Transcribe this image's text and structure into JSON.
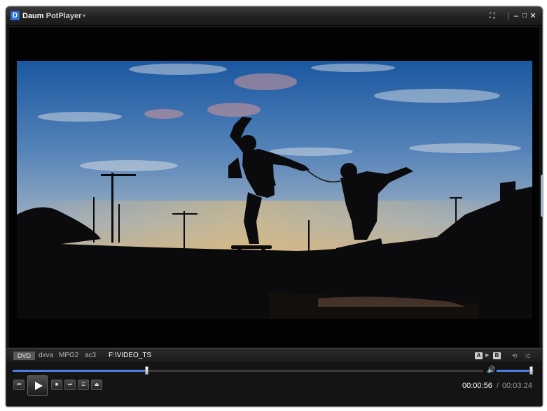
{
  "titlebar": {
    "logo_letter": "D",
    "app_name_part1": "Daum",
    "app_name_part2": " PotPlayer",
    "menu_caret": "▾",
    "btn_fullscreen": "⛶",
    "btn_minimize": "–",
    "btn_maximize": "□",
    "btn_close": "✕"
  },
  "video": {
    "scene": "sunset skateboard silhouette"
  },
  "infobar": {
    "source_badge": "DVD",
    "decoder": "dxva",
    "video_codec": "MPG2",
    "audio_codec": "ac3",
    "path": "F:\\VIDEO_TS",
    "ab_a": "A",
    "ab_b": "B",
    "ab_arrow": "▶",
    "repeat_icon": "⟲",
    "shuffle_icon": "⤨"
  },
  "seek": {
    "progress": 0.2857
  },
  "volume": {
    "icon": "🔊",
    "level": 0.92
  },
  "controls": {
    "prev_glyph": "⏮",
    "stop_glyph": "■",
    "next_glyph": "⏭",
    "playlist_glyph": "☰",
    "eject_glyph": "⏏"
  },
  "time": {
    "current": "00:00:56",
    "separator": "/",
    "total": "00:03:24"
  },
  "colors": {
    "accent": "#4d7de0",
    "logo": "#2d6fd6"
  }
}
